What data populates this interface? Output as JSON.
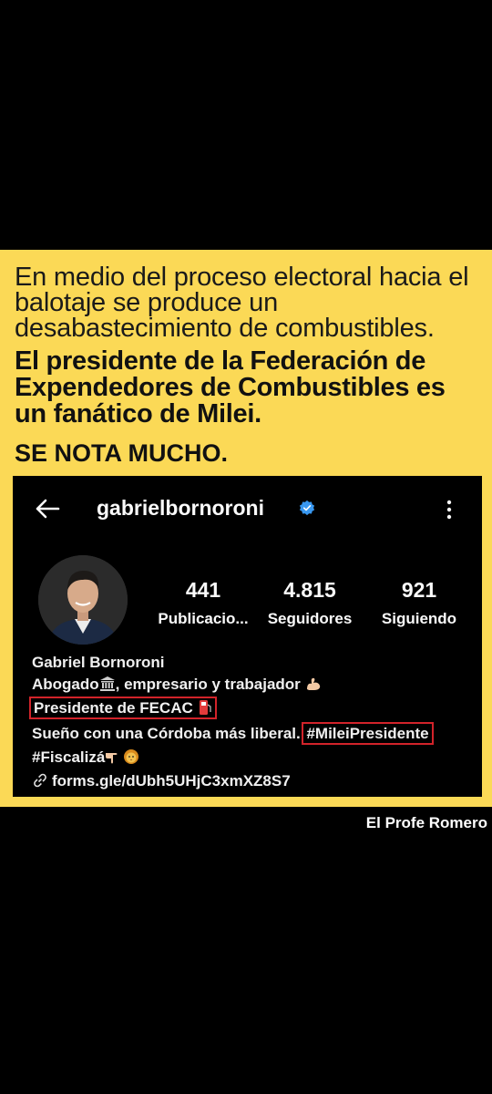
{
  "intro_text": "En medio del proceso electoral hacia el balotaje se produce un desabastecimiento de combustibles.",
  "bold_text": "El presidente de la Federación de Expendedores de Combustibles es un fanático de Milei.",
  "highlight_text": "SE NOTA MUCHO.",
  "profile": {
    "username": "gabrielbornoroni",
    "verified": true,
    "stats": [
      {
        "value": "441",
        "label": "Publicacio..."
      },
      {
        "value": "4.815",
        "label": "Seguidores"
      },
      {
        "value": "921",
        "label": "Siguiendo"
      }
    ],
    "name": "Gabriel Bornoroni",
    "bio_line_1": "Abogado",
    "bio_line_1_rest": ", empresario y trabajador",
    "bio_line_2": "Presidente de FECAC",
    "bio_line_3": "Sueño con una Córdoba más liberal.",
    "hashtag_1": "#MileiPresidente",
    "hashtag_2": "#Fiscalizá",
    "link": "forms.gle/dUbh5UHjC3xmXZ8S7"
  },
  "credit": "El Profe Romero",
  "icons": [
    "back-arrow-icon",
    "verified-badge-icon",
    "more-options-icon",
    "bank-icon",
    "flexed-biceps-icon",
    "fuel-pump-icon",
    "pointing-down-icon",
    "lion-icon",
    "link-icon"
  ],
  "colors": {
    "card_bg": "#fbd956",
    "highlight_border": "#d2232a",
    "verified_blue": "#3897f0"
  }
}
